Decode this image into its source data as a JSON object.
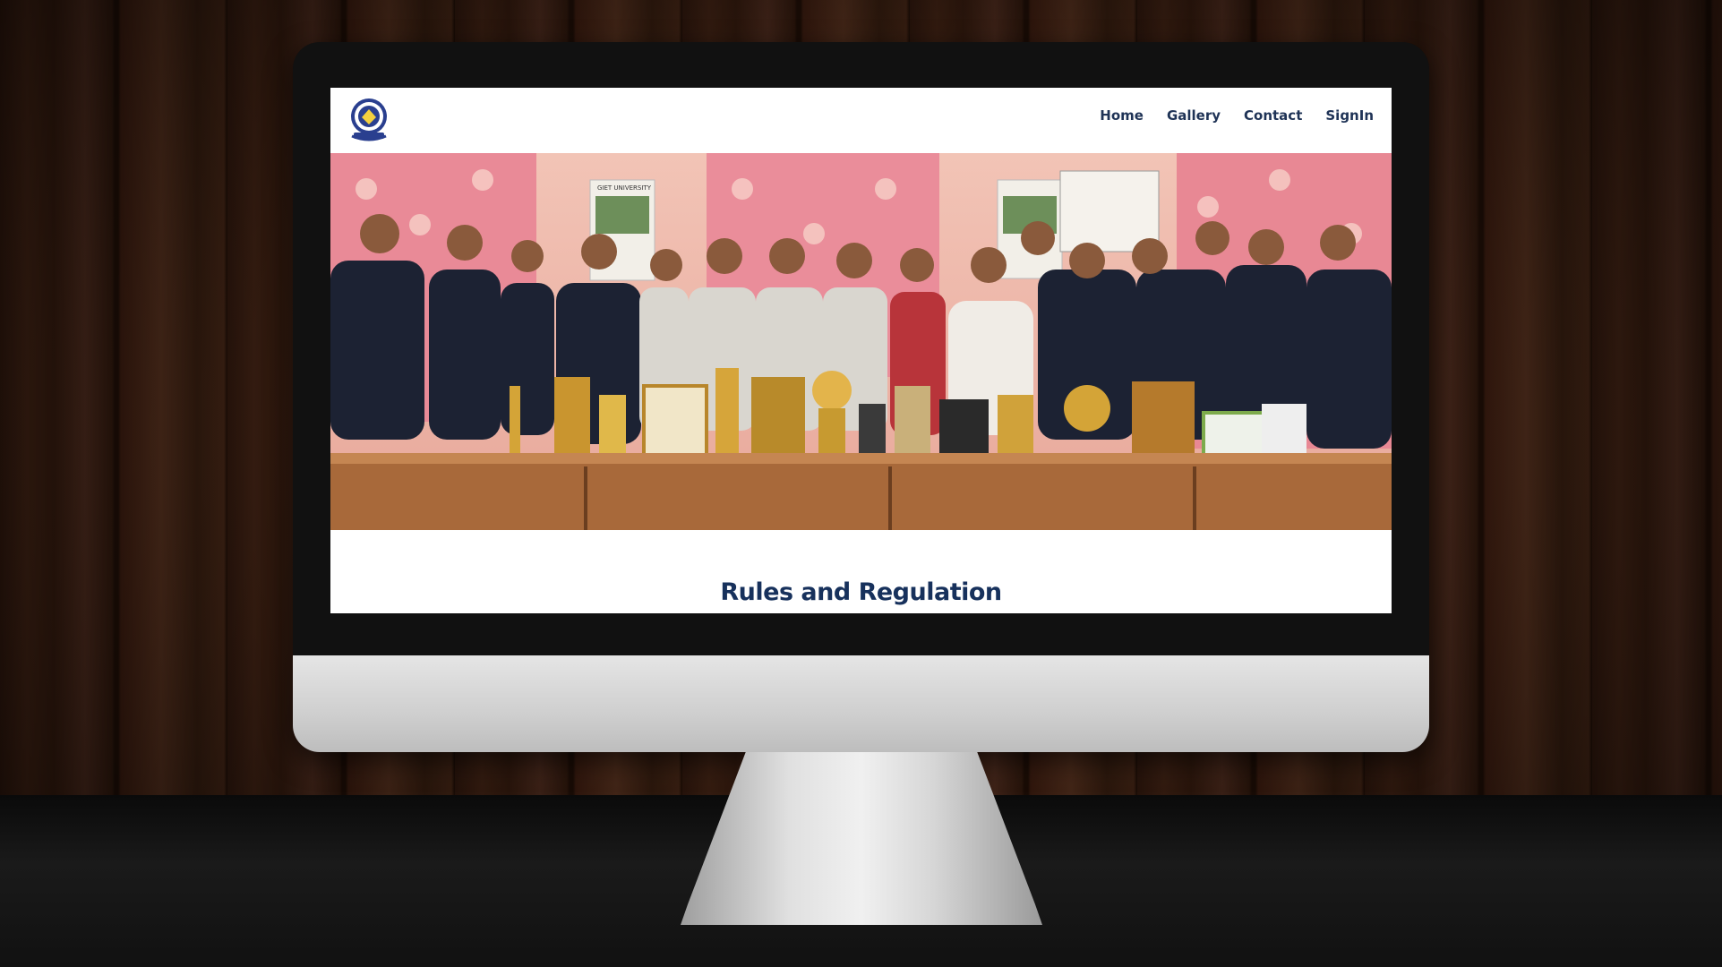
{
  "nav": {
    "logo_icon": "university-crest-icon",
    "links": [
      "Home",
      "Gallery",
      "Contact",
      "SignIn"
    ]
  },
  "hero": {
    "image": "group-photo-with-trophies",
    "wall_calendar_text": "GIET UNIVERSITY"
  },
  "section": {
    "title": "Rules and Regulation"
  },
  "colors": {
    "nav_text": "#1f3356",
    "title": "#17315c",
    "background_wood": "#3a1f12"
  }
}
